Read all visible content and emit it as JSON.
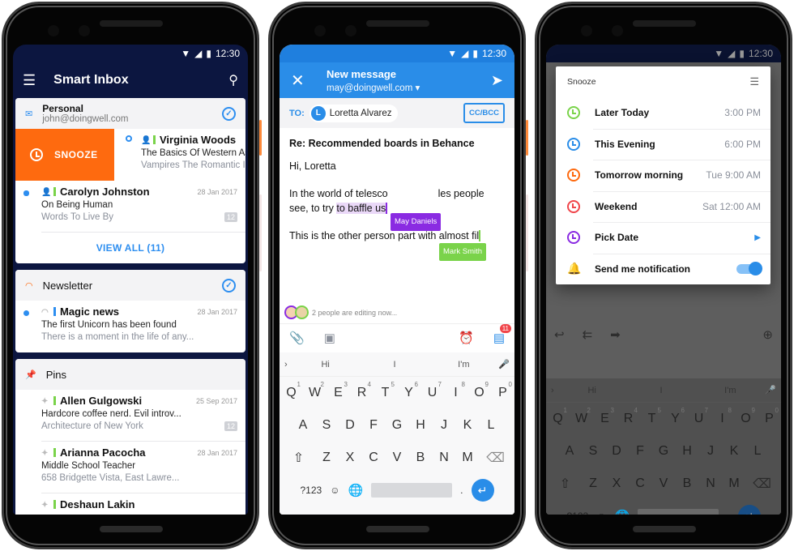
{
  "status": {
    "time": "12:30"
  },
  "inbox": {
    "title": "Smart Inbox",
    "personal": {
      "title": "Personal",
      "email": "john@doingwell.com"
    },
    "swipe_action": "SNOOZE",
    "messages": [
      {
        "sender": "Virginia Woods",
        "subject": "The Basics Of Western Astr",
        "preview": "Vampires The Romantic Ide",
        "date": "",
        "count": ""
      },
      {
        "sender": "Carolyn Johnston",
        "subject": "On Being Human",
        "preview": "Words To Live By",
        "date": "28 Jan 2017",
        "count": "12"
      }
    ],
    "view_all": "VIEW ALL (11)",
    "newsletter": {
      "title": "Newsletter",
      "message": {
        "sender": "Magic news",
        "subject": "The first Unicorn has been found",
        "preview": "There is a moment in the life of any...",
        "date": "28 Jan 2017"
      }
    },
    "pins": {
      "title": "Pins",
      "messages": [
        {
          "sender": "Allen Gulgowski",
          "subject": "Hardcore coffee nerd. Evil introv...",
          "preview": "Architecture of New York",
          "date": "25 Sep 2017",
          "count": "12"
        },
        {
          "sender": "Arianna Pacocha",
          "subject": "Middle School Teacher",
          "preview": "658 Bridgette Vista, East Lawre...",
          "date": "28 Jan 2017",
          "count": ""
        },
        {
          "sender": "Deshaun Lakin",
          "subject": "",
          "preview": "",
          "date": "",
          "count": ""
        }
      ]
    }
  },
  "compose": {
    "title": "New message",
    "from": "may@doingwell.com",
    "to_label": "TO:",
    "recipient_initial": "L",
    "recipient": "Loretta Alvarez",
    "ccbcc": "CC/BCC",
    "subject": "Re: Recommended boards in Behance",
    "greeting": "Hi, Loretta",
    "line1": "In the world of telesco",
    "line1_end": "les people",
    "line2": "see, to try ",
    "line2_sel": "to baffle us",
    "line3": "This is the other person part with almost fil",
    "collab1": "May Daniels",
    "collab2": "Mark Smith",
    "editing_status": "2 people are editing now...",
    "chat_badge": "11"
  },
  "keyboard": {
    "suggestions": [
      "Hi",
      "I",
      "I'm"
    ],
    "row1": [
      "Q",
      "W",
      "E",
      "R",
      "T",
      "Y",
      "U",
      "I",
      "O",
      "P"
    ],
    "row1_nums": [
      "1",
      "2",
      "3",
      "4",
      "5",
      "6",
      "7",
      "8",
      "9",
      "0"
    ],
    "row2": [
      "A",
      "S",
      "D",
      "F",
      "G",
      "H",
      "J",
      "K",
      "L"
    ],
    "row3": [
      "Z",
      "X",
      "C",
      "V",
      "B",
      "N",
      "M"
    ],
    "symbols": "?123",
    "period": "."
  },
  "snooze": {
    "title": "Snooze",
    "options": [
      {
        "label": "Later Today",
        "value": "3:00 PM",
        "color": "#7ad34a"
      },
      {
        "label": "This Evening",
        "value": "6:00 PM",
        "color": "#2a8de8"
      },
      {
        "label": "Tomorrow morning",
        "value": "Tue 9:00 AM",
        "color": "#fe6a0f"
      },
      {
        "label": "Weekend",
        "value": "Sat 12:00 AM",
        "color": "#f0454a"
      },
      {
        "label": "Pick Date",
        "value": "",
        "color": "#8a2be2"
      }
    ],
    "notify_label": "Send me notification",
    "notify_on": true
  }
}
